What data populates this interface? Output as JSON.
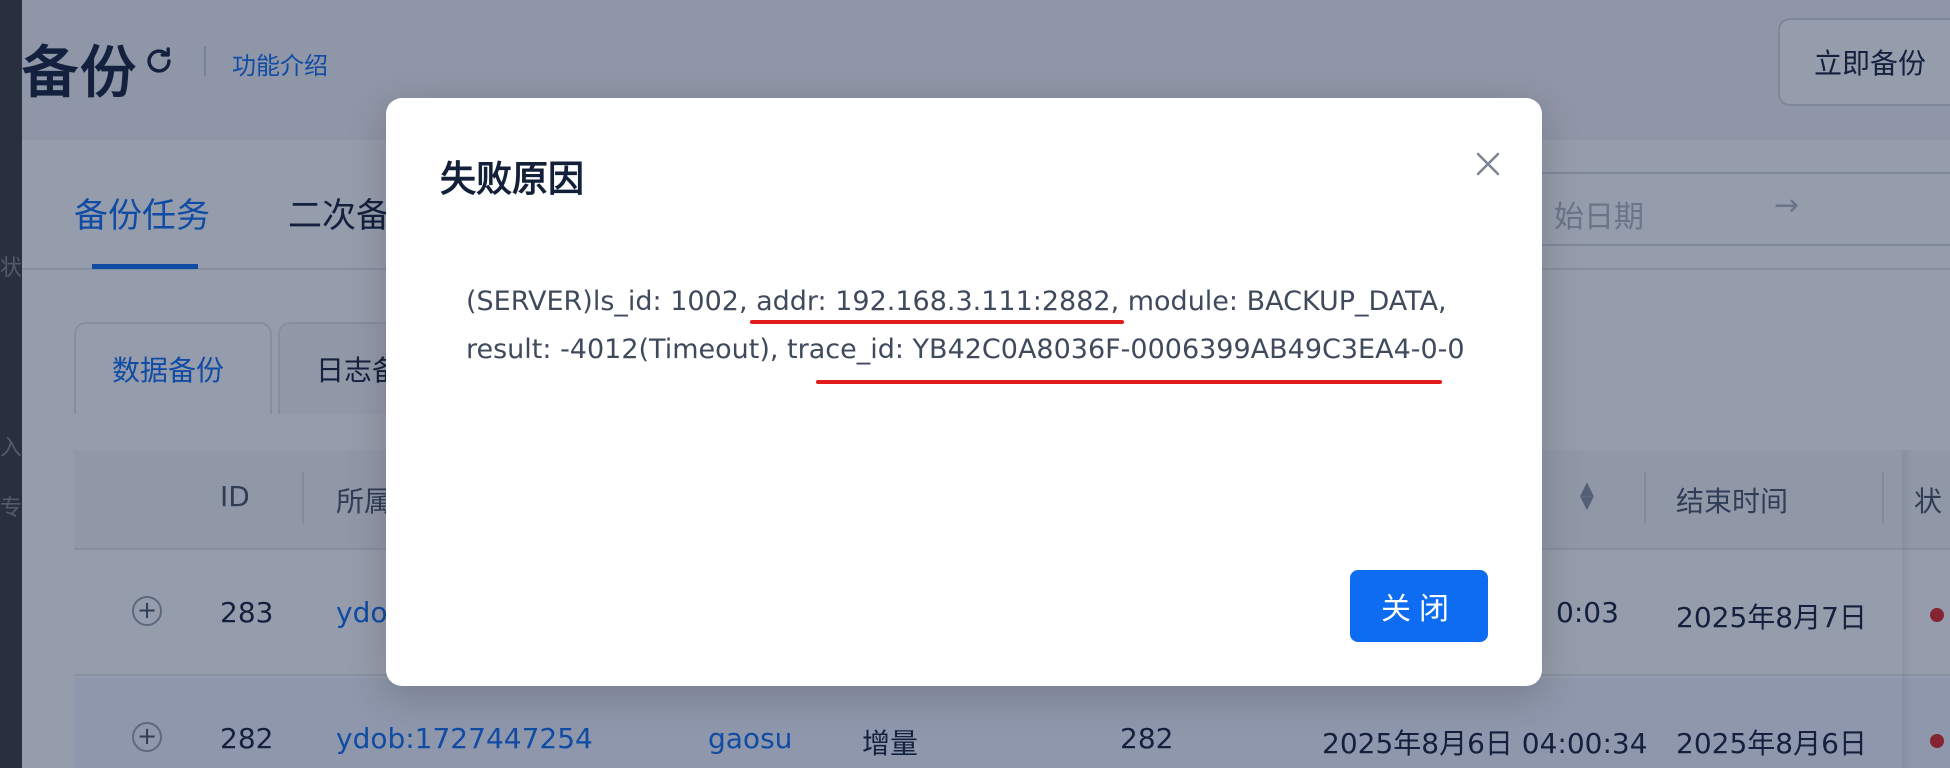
{
  "left_strip": {
    "fragments": [
      "状",
      "入",
      "专"
    ]
  },
  "header": {
    "title": "备份",
    "intro_link": "功能介绍",
    "backup_now": "立即备份"
  },
  "tabs": {
    "items": [
      "备份任务",
      "二次备"
    ],
    "date_placeholder": "始日期",
    "date_arrow": "→"
  },
  "subtabs": [
    "数据备份",
    "日志备"
  ],
  "table": {
    "headers": [
      "ID",
      "所属",
      "结束时间",
      "状"
    ],
    "rows": [
      {
        "id": "283",
        "name": "ydo",
        "col_start_fragment": "0:03",
        "end": "2025年8月7日"
      },
      {
        "id": "282",
        "name": "ydob:1727447254",
        "user": "gaosu",
        "type": "增量",
        "seq": "282",
        "start": "2025年8月6日 04:00:34",
        "end": "2025年8月6日"
      }
    ]
  },
  "modal": {
    "title": "失败原因",
    "message_line1": "(SERVER)ls_id: 1002, addr: 192.168.3.111:2882, module: BACKUP_DATA,",
    "message_line2": "result: -4012(Timeout), trace_id: YB42C0A8036F-0006399AB49C3EA4-0-0",
    "close_button": "关闭",
    "annotation_color": "#e21b1b"
  },
  "colors": {
    "accent": "#0d6cf2",
    "status_error": "#e02424"
  }
}
